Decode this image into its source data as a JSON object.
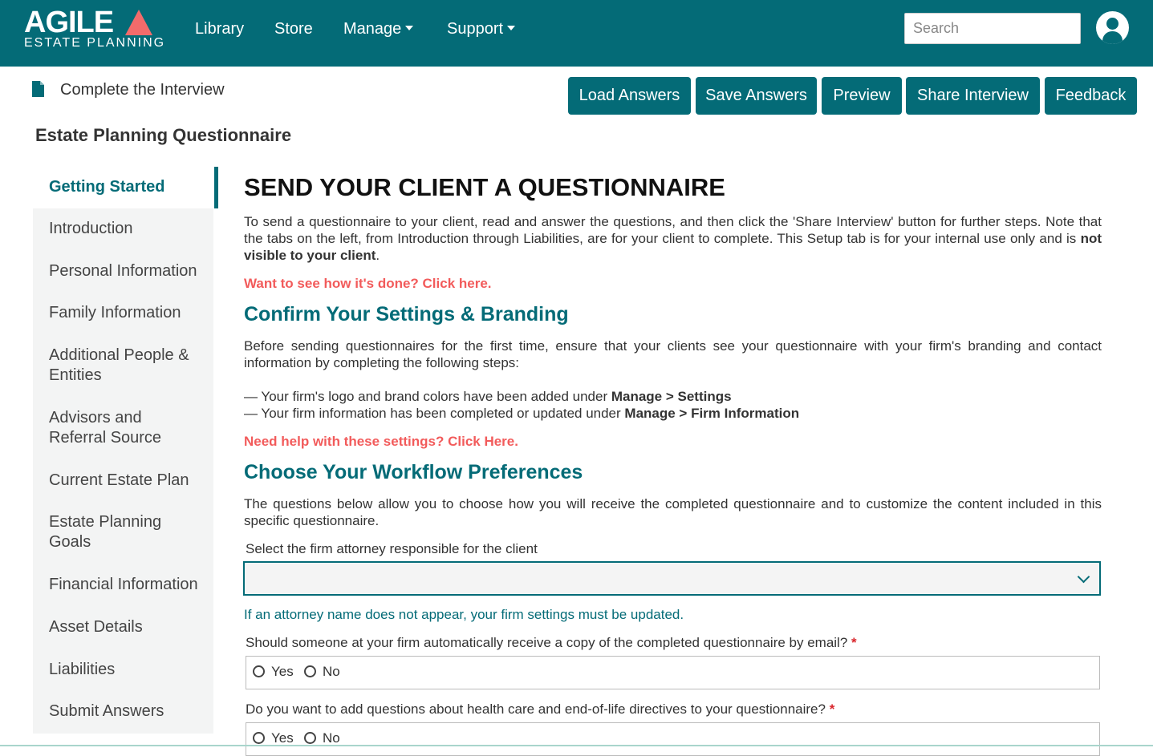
{
  "header": {
    "logo_text": "AGILE",
    "logo_subtext": "ESTATE PLANNING",
    "nav": [
      "Library",
      "Store",
      "Manage",
      "Support"
    ],
    "search_placeholder": "Search",
    "colors": {
      "brand": "#046b77",
      "accent": "#f26b6b"
    }
  },
  "toolbar": {
    "breadcrumb": "Complete the Interview",
    "buttons": [
      "Load Answers",
      "Save Answers",
      "Preview",
      "Share Interview",
      "Feedback"
    ]
  },
  "page_title": "Estate Planning Questionnaire",
  "sidebar": {
    "items": [
      {
        "label": "Getting Started"
      },
      {
        "label": "Introduction"
      },
      {
        "label": "Personal Information"
      },
      {
        "label": "Family Information"
      },
      {
        "label": "Additional People & Entities"
      },
      {
        "label": "Advisors and Referral Source"
      },
      {
        "label": "Current Estate Plan"
      },
      {
        "label": "Estate Planning Goals"
      },
      {
        "label": "Financial Information"
      },
      {
        "label": "Asset Details"
      },
      {
        "label": "Liabilities"
      },
      {
        "label": "Submit Answers"
      }
    ]
  },
  "main": {
    "heading": "SEND YOUR CLIENT A QUESTIONNAIRE",
    "intro_text": "To send a questionnaire to your client, read and answer the questions, and then click the 'Share Interview' button for further steps. Note that the tabs on the left, from Introduction through Liabilities, are for your client to complete. This Setup tab is for your internal use only and is ",
    "intro_bold": "not visible to your client",
    "intro_end": ".",
    "demo_link": "Want to see how it's done? Click here.",
    "settings_heading": "Confirm Your Settings & Branding",
    "settings_text": "Before sending questionnaires for the first time, ensure that your clients see your questionnaire with your firm's branding and contact information by completing the following steps:",
    "steps": [
      {
        "text": "— Your firm's logo and brand colors have been added under ",
        "bold": "Manage > Settings"
      },
      {
        "text": "— Your firm information has been completed or updated under ",
        "bold": "Manage > Firm Information"
      }
    ],
    "help_link": "Need help with these settings? Click Here.",
    "workflow_heading": "Choose Your Workflow Preferences",
    "workflow_text": "The questions below allow you to choose how you will receive the completed questionnaire and to customize the content included in this specific questionnaire.",
    "attorney_label": "Select the firm attorney responsible for the client",
    "attorney_value": "",
    "attorney_hint": "If an attorney name does not appear, your firm settings must be updated.",
    "questions": [
      {
        "label": "Should someone at your firm automatically receive a copy of the completed questionnaire by email?",
        "required": "*",
        "options": [
          "Yes",
          "No"
        ]
      },
      {
        "label": "Do you want to add questions about health care and end-of-life directives to your questionnaire?",
        "required": "*",
        "options": [
          "Yes",
          "No"
        ]
      }
    ]
  }
}
